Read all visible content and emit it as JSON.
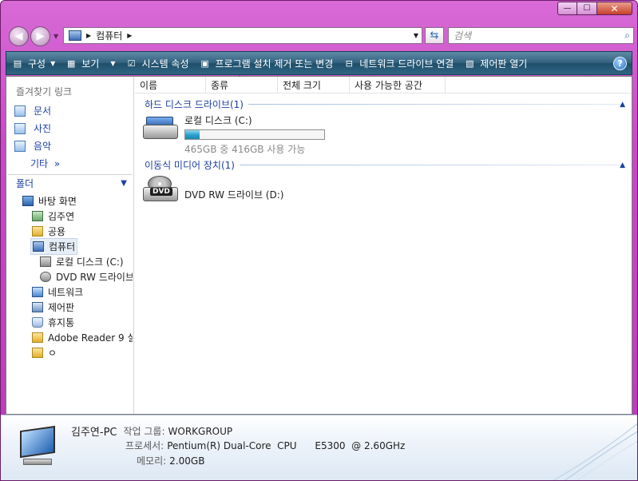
{
  "window": {
    "caption": {
      "minimize": "—",
      "maximize": "☐",
      "close": "✕"
    }
  },
  "address": {
    "path": [
      "컴퓨터"
    ],
    "search_placeholder": "검색"
  },
  "toolbar": {
    "organize": "구성",
    "views": "보기",
    "system_properties": "시스템 속성",
    "uninstall": "프로그램 설치 제거 또는 변경",
    "map_drive": "네트워크 드라이브 연결",
    "control_panel": "제어판 열기",
    "help": "?"
  },
  "nav": {
    "favorites_title": "즐겨찾기 링크",
    "favorites": [
      "문서",
      "사진",
      "음악"
    ],
    "more": "기타",
    "folders_title": "폴더",
    "tree": [
      {
        "label": "바탕 화면",
        "icon": "desktop-icon"
      },
      {
        "label": "김주연",
        "icon": "user-folder-icon"
      },
      {
        "label": "공용",
        "icon": "folder-icon"
      },
      {
        "label": "컴퓨터",
        "icon": "computer-icon"
      },
      {
        "label": "로컬 디스크 (C:)",
        "icon": "disk-icon"
      },
      {
        "label": "DVD RW 드라이브",
        "icon": "dvd-icon"
      },
      {
        "label": "네트워크",
        "icon": "network-icon"
      },
      {
        "label": "제어판",
        "icon": "control-panel-icon"
      },
      {
        "label": "휴지통",
        "icon": "recycle-bin-icon"
      },
      {
        "label": "Adobe Reader 9 설:",
        "icon": "folder-icon"
      },
      {
        "label": "ㅇ",
        "icon": "folder-icon"
      }
    ]
  },
  "columns": [
    "이름",
    "종류",
    "전체 크기",
    "사용 가능한 공간"
  ],
  "groups": {
    "hdd": "하드 디스크 드라이브(1)",
    "removable": "이동식 미디어 장치(1)"
  },
  "drives": {
    "c": {
      "name": "로컬 디스크 (C:)",
      "space": "465GB 중 416GB 사용 가능",
      "used_fraction": 0.105
    },
    "d": {
      "name": "DVD RW 드라이브 (D:)",
      "label": "DVD"
    }
  },
  "details": {
    "pc_name": "김주연-PC",
    "workgroup_label": "작업 그룹:",
    "workgroup": "WORKGROUP",
    "cpu_label": "프로세서:",
    "cpu": "Pentium(R) Dual-Core  CPU      E5300  @ 2.60GHz",
    "mem_label": "메모리:",
    "mem": "2.00GB"
  },
  "colors": {
    "frame": "#c84ac6",
    "toolbar": "#2f6684",
    "link": "#1c3fa0",
    "bar_fill": "#2aa0cc"
  }
}
